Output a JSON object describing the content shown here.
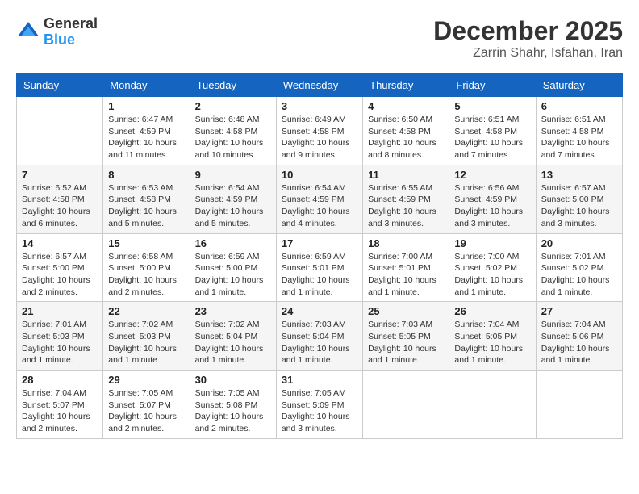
{
  "logo": {
    "general": "General",
    "blue": "Blue"
  },
  "title": "December 2025",
  "location": "Zarrin Shahr, Isfahan, Iran",
  "days_of_week": [
    "Sunday",
    "Monday",
    "Tuesday",
    "Wednesday",
    "Thursday",
    "Friday",
    "Saturday"
  ],
  "weeks": [
    [
      {
        "day": "",
        "info": ""
      },
      {
        "day": "1",
        "info": "Sunrise: 6:47 AM\nSunset: 4:59 PM\nDaylight: 10 hours and 11 minutes."
      },
      {
        "day": "2",
        "info": "Sunrise: 6:48 AM\nSunset: 4:58 PM\nDaylight: 10 hours and 10 minutes."
      },
      {
        "day": "3",
        "info": "Sunrise: 6:49 AM\nSunset: 4:58 PM\nDaylight: 10 hours and 9 minutes."
      },
      {
        "day": "4",
        "info": "Sunrise: 6:50 AM\nSunset: 4:58 PM\nDaylight: 10 hours and 8 minutes."
      },
      {
        "day": "5",
        "info": "Sunrise: 6:51 AM\nSunset: 4:58 PM\nDaylight: 10 hours and 7 minutes."
      },
      {
        "day": "6",
        "info": "Sunrise: 6:51 AM\nSunset: 4:58 PM\nDaylight: 10 hours and 7 minutes."
      }
    ],
    [
      {
        "day": "7",
        "info": "Sunrise: 6:52 AM\nSunset: 4:58 PM\nDaylight: 10 hours and 6 minutes."
      },
      {
        "day": "8",
        "info": "Sunrise: 6:53 AM\nSunset: 4:58 PM\nDaylight: 10 hours and 5 minutes."
      },
      {
        "day": "9",
        "info": "Sunrise: 6:54 AM\nSunset: 4:59 PM\nDaylight: 10 hours and 5 minutes."
      },
      {
        "day": "10",
        "info": "Sunrise: 6:54 AM\nSunset: 4:59 PM\nDaylight: 10 hours and 4 minutes."
      },
      {
        "day": "11",
        "info": "Sunrise: 6:55 AM\nSunset: 4:59 PM\nDaylight: 10 hours and 3 minutes."
      },
      {
        "day": "12",
        "info": "Sunrise: 6:56 AM\nSunset: 4:59 PM\nDaylight: 10 hours and 3 minutes."
      },
      {
        "day": "13",
        "info": "Sunrise: 6:57 AM\nSunset: 5:00 PM\nDaylight: 10 hours and 3 minutes."
      }
    ],
    [
      {
        "day": "14",
        "info": "Sunrise: 6:57 AM\nSunset: 5:00 PM\nDaylight: 10 hours and 2 minutes."
      },
      {
        "day": "15",
        "info": "Sunrise: 6:58 AM\nSunset: 5:00 PM\nDaylight: 10 hours and 2 minutes."
      },
      {
        "day": "16",
        "info": "Sunrise: 6:59 AM\nSunset: 5:00 PM\nDaylight: 10 hours and 1 minute."
      },
      {
        "day": "17",
        "info": "Sunrise: 6:59 AM\nSunset: 5:01 PM\nDaylight: 10 hours and 1 minute."
      },
      {
        "day": "18",
        "info": "Sunrise: 7:00 AM\nSunset: 5:01 PM\nDaylight: 10 hours and 1 minute."
      },
      {
        "day": "19",
        "info": "Sunrise: 7:00 AM\nSunset: 5:02 PM\nDaylight: 10 hours and 1 minute."
      },
      {
        "day": "20",
        "info": "Sunrise: 7:01 AM\nSunset: 5:02 PM\nDaylight: 10 hours and 1 minute."
      }
    ],
    [
      {
        "day": "21",
        "info": "Sunrise: 7:01 AM\nSunset: 5:03 PM\nDaylight: 10 hours and 1 minute."
      },
      {
        "day": "22",
        "info": "Sunrise: 7:02 AM\nSunset: 5:03 PM\nDaylight: 10 hours and 1 minute."
      },
      {
        "day": "23",
        "info": "Sunrise: 7:02 AM\nSunset: 5:04 PM\nDaylight: 10 hours and 1 minute."
      },
      {
        "day": "24",
        "info": "Sunrise: 7:03 AM\nSunset: 5:04 PM\nDaylight: 10 hours and 1 minute."
      },
      {
        "day": "25",
        "info": "Sunrise: 7:03 AM\nSunset: 5:05 PM\nDaylight: 10 hours and 1 minute."
      },
      {
        "day": "26",
        "info": "Sunrise: 7:04 AM\nSunset: 5:05 PM\nDaylight: 10 hours and 1 minute."
      },
      {
        "day": "27",
        "info": "Sunrise: 7:04 AM\nSunset: 5:06 PM\nDaylight: 10 hours and 1 minute."
      }
    ],
    [
      {
        "day": "28",
        "info": "Sunrise: 7:04 AM\nSunset: 5:07 PM\nDaylight: 10 hours and 2 minutes."
      },
      {
        "day": "29",
        "info": "Sunrise: 7:05 AM\nSunset: 5:07 PM\nDaylight: 10 hours and 2 minutes."
      },
      {
        "day": "30",
        "info": "Sunrise: 7:05 AM\nSunset: 5:08 PM\nDaylight: 10 hours and 2 minutes."
      },
      {
        "day": "31",
        "info": "Sunrise: 7:05 AM\nSunset: 5:09 PM\nDaylight: 10 hours and 3 minutes."
      },
      {
        "day": "",
        "info": ""
      },
      {
        "day": "",
        "info": ""
      },
      {
        "day": "",
        "info": ""
      }
    ]
  ]
}
